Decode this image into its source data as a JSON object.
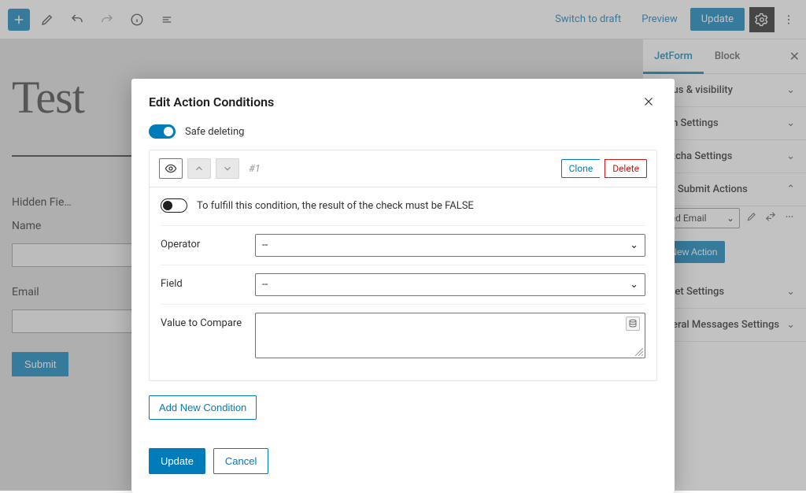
{
  "toolbar": {
    "switch_draft": "Switch to draft",
    "preview": "Preview",
    "update": "Update"
  },
  "canvas": {
    "title": "Test",
    "hidden_field_label": "Hidden Fie…",
    "name_label": "Name",
    "email_label": "Email",
    "submit": "Submit"
  },
  "sidebar": {
    "tabs": {
      "jetform": "JetForm",
      "block": "Block"
    },
    "panels": {
      "status": "Status & visibility",
      "form": "Form Settings",
      "captcha": "Captcha Settings",
      "post_submit": "Post Submit Actions",
      "preset": "Preset Settings",
      "general": "General Messages Settings"
    },
    "action_value": "Send Email",
    "new_action": "+ New Action"
  },
  "modal": {
    "title": "Edit Action Conditions",
    "safe_deleting": "Safe deleting",
    "cond_number": "#1",
    "clone": "Clone",
    "delete": "Delete",
    "false_hint": "To fulfill this condition, the result of the check must be FALSE",
    "operator_label": "Operator",
    "operator_value": "--",
    "field_label": "Field",
    "field_value": "--",
    "value_label": "Value to Compare",
    "add_condition": "Add New Condition",
    "update": "Update",
    "cancel": "Cancel"
  }
}
